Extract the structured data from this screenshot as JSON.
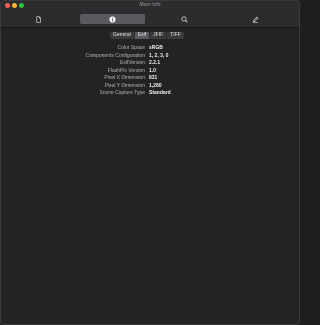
{
  "window": {
    "title": "More Info"
  },
  "toolbar": {
    "buttons": [
      {
        "name": "general-file",
        "icon": "document-icon"
      },
      {
        "name": "info",
        "icon": "info-icon",
        "selected": true
      },
      {
        "name": "inspect",
        "icon": "magnifier-icon"
      },
      {
        "name": "annotate",
        "icon": "pencil-icon"
      }
    ]
  },
  "tabs": [
    "General",
    "Exif",
    "JFIF",
    "TIFF"
  ],
  "active_tab": "Exif",
  "properties": [
    {
      "key": "Color Space",
      "value": "sRGB"
    },
    {
      "key": "Components Configuration",
      "value": "1, 2, 3, 0"
    },
    {
      "key": "ExifVersion",
      "value": "2.2.1"
    },
    {
      "key": "FlashPix Version",
      "value": "1.0"
    },
    {
      "key": "Pixel X Dimension",
      "value": "831"
    },
    {
      "key": "Pixel Y Dimension",
      "value": "1,280"
    },
    {
      "key": "Scene Capture Type",
      "value": "Standard"
    }
  ],
  "colors": {
    "window_bg": "#232325",
    "toolbar_bg": "#2c2c2e",
    "selected_bg": "#5a5a5e",
    "close": "#ff5f57",
    "minimize": "#febc2e",
    "maximize": "#28c840"
  }
}
